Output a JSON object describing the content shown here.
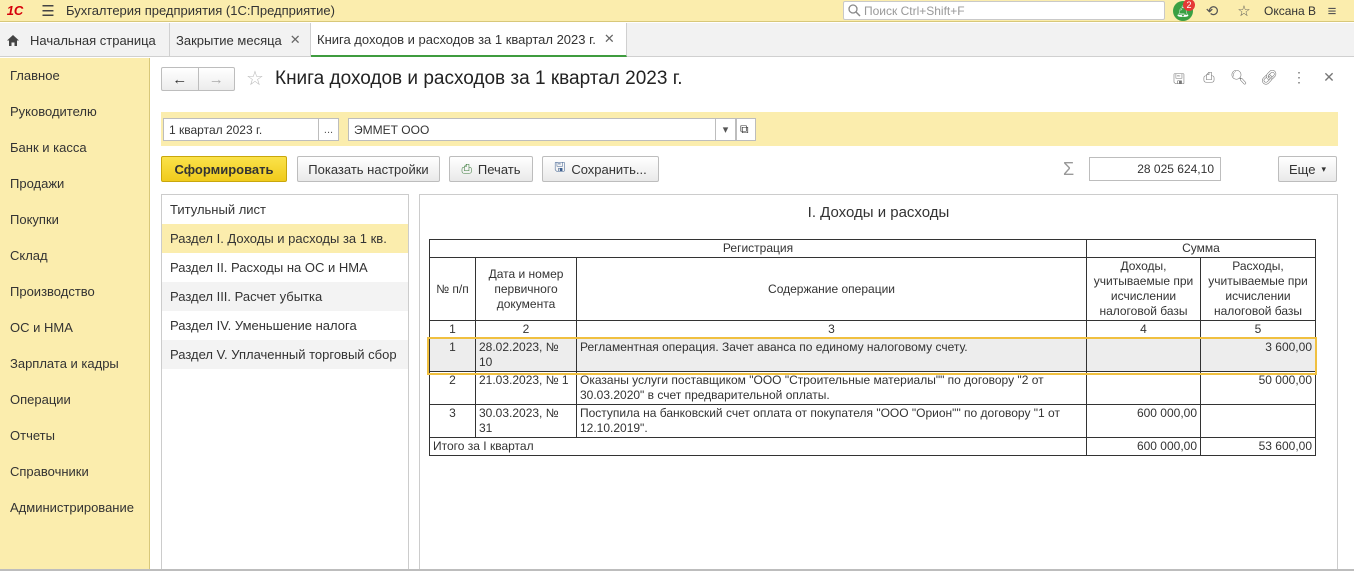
{
  "app": {
    "logo": "1С",
    "title": "Бухгалтерия предприятия  (1С:Предприятие)",
    "search_placeholder": "Поиск Ctrl+Shift+F",
    "notifications_count": "2",
    "user": "Оксана В"
  },
  "tabs": [
    {
      "label": "Начальная страница"
    },
    {
      "label": "Закрытие месяца"
    },
    {
      "label": "Книга доходов и расходов за 1 квартал 2023 г."
    }
  ],
  "sidebar": {
    "items": [
      {
        "label": "Главное"
      },
      {
        "label": "Руководителю"
      },
      {
        "label": "Банк и касса"
      },
      {
        "label": "Продажи"
      },
      {
        "label": "Покупки"
      },
      {
        "label": "Склад"
      },
      {
        "label": "Производство"
      },
      {
        "label": "ОС и НМА"
      },
      {
        "label": "Зарплата и кадры"
      },
      {
        "label": "Операции"
      },
      {
        "label": "Отчеты"
      },
      {
        "label": "Справочники"
      },
      {
        "label": "Администрирование"
      }
    ]
  },
  "document": {
    "title": "Книга доходов и расходов за 1 квартал 2023 г.",
    "period": "1 квартал 2023 г.",
    "period_btn": "...",
    "organization": "ЭММЕТ ООО"
  },
  "toolbar": {
    "generate": "Сформировать",
    "show_settings": "Показать настройки",
    "print": "Печать",
    "save": "Сохранить...",
    "sum": "28 025 624,10",
    "more": "Еще"
  },
  "sections": [
    {
      "label": "Титульный лист"
    },
    {
      "label": "Раздел I. Доходы и расходы за 1 кв."
    },
    {
      "label": "Раздел II. Расходы на ОС и НМА"
    },
    {
      "label": "Раздел III. Расчет убытка"
    },
    {
      "label": "Раздел IV. Уменьшение налога"
    },
    {
      "label": "Раздел V. Уплаченный торговый сбор"
    }
  ],
  "report": {
    "title": "I. Доходы и расходы",
    "header": {
      "registration": "Регистрация",
      "sum": "Сумма",
      "num": "№ п/п",
      "date_doc": "Дата и номер первичного документа",
      "content": "Содержание операции",
      "income": "Доходы, учитываемые при исчислении налоговой базы",
      "expense": "Расходы, учитываемые при исчислении налоговой базы"
    },
    "col_numbers": [
      "1",
      "2",
      "3",
      "4",
      "5"
    ],
    "rows": [
      {
        "num": "1",
        "date": "28.02.2023, № 10",
        "content": "Регламентная операция. Зачет аванса по единому налоговому счету.",
        "income": "",
        "expense": "3 600,00"
      },
      {
        "num": "2",
        "date": "21.03.2023, № 1",
        "content": "Оказаны услуги поставщиком \"ООО \"Строительные материалы\"\" по договору \"2 от 30.03.2020\" в счет предварительной оплаты.",
        "income": "",
        "expense": "50 000,00"
      },
      {
        "num": "3",
        "date": "30.03.2023, № 31",
        "content": "Поступила на банковский счет оплата от покупателя \"ООО \"Орион\"\" по договору \"1 от 12.10.2019\".",
        "income": "600 000,00",
        "expense": ""
      }
    ],
    "total": {
      "label": "Итого за I квартал",
      "income": "600 000,00",
      "expense": "53 600,00"
    }
  }
}
